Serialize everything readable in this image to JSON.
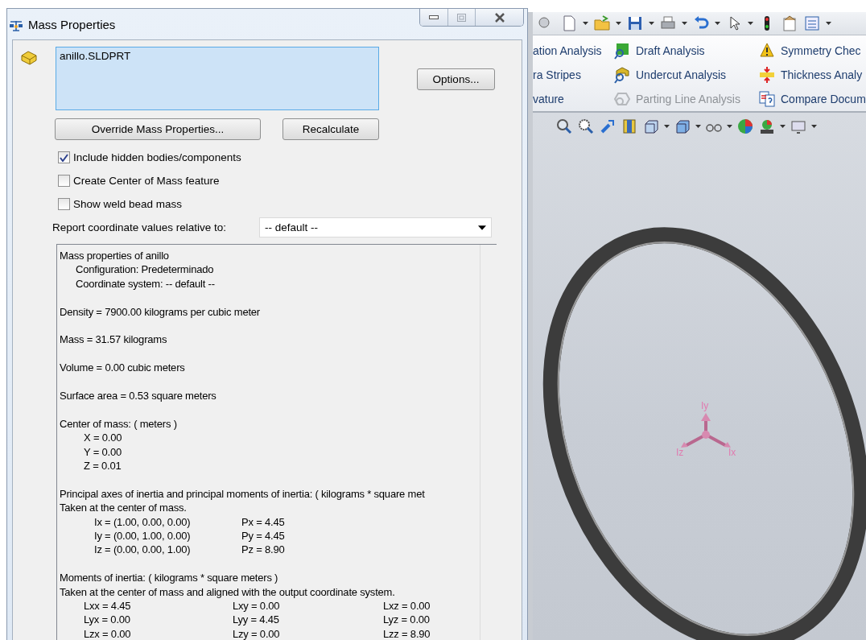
{
  "dialog": {
    "title": "Mass Properties",
    "selection": "anillo.SLDPRT",
    "buttons": {
      "options": "Options...",
      "override": "Override Mass Properties...",
      "recalculate": "Recalculate"
    },
    "checkboxes": [
      {
        "label": "Include hidden bodies/components",
        "checked": true
      },
      {
        "label": "Create Center of Mass feature",
        "checked": false
      },
      {
        "label": "Show weld bead mass",
        "checked": false
      }
    ],
    "coordinate": {
      "label": "Report coordinate values relative to:",
      "value": "-- default --"
    },
    "report": [
      {
        "lines": [
          "Mass properties of anillo"
        ],
        "children": [
          "Configuration: Predeterminado",
          "Coordinate system: -- default --"
        ]
      },
      {
        "lines": [
          "Density = 7900.00 kilograms per cubic meter"
        ]
      },
      {
        "lines": [
          "Mass = 31.57 kilograms"
        ]
      },
      {
        "lines": [
          "Volume = 0.00 cubic meters"
        ]
      },
      {
        "lines": [
          "Surface area = 0.53 square meters"
        ]
      },
      {
        "lines": [
          "Center of mass: ( meters )"
        ],
        "rows": [
          [
            "X = 0.00"
          ],
          [
            "Y = 0.00"
          ],
          [
            "Z = 0.01"
          ]
        ]
      },
      {
        "lines": [
          "Principal axes of inertia and principal moments of inertia: ( kilograms * square met",
          "Taken at the center of mass."
        ],
        "rows": [
          [
            "Ix = (1.00, 0.00, 0.00)",
            "Px = 4.45"
          ],
          [
            "Iy = (0.00, 1.00, 0.00)",
            "Py = 4.45"
          ],
          [
            "Iz = (0.00, 0.00, 1.00)",
            "Pz = 8.90"
          ]
        ]
      },
      {
        "lines": [
          "Moments of inertia: ( kilograms * square meters )",
          "Taken at the center of mass and aligned with the output coordinate system."
        ],
        "rows": [
          [
            "Lxx = 4.45",
            "Lxy = 0.00",
            "Lxz = 0.00"
          ],
          [
            "Lyx = 0.00",
            "Lyy = 4.45",
            "Lyz = 0.00"
          ],
          [
            "Lzx = 0.00",
            "Lzy = 0.00",
            "Lzz = 8.90"
          ]
        ]
      }
    ]
  },
  "command_manager": [
    {
      "label": "ation Analysis",
      "disabled": false,
      "kind": "text"
    },
    {
      "label": "Draft Analysis",
      "disabled": false,
      "kind": "draft"
    },
    {
      "label": "Symmetry Chec",
      "disabled": false,
      "kind": "warning"
    },
    {
      "label": "ra Stripes",
      "disabled": false,
      "kind": "text"
    },
    {
      "label": "Undercut Analysis",
      "disabled": false,
      "kind": "undercut"
    },
    {
      "label": "Thickness Analy",
      "disabled": false,
      "kind": "thickness"
    },
    {
      "label": "vature",
      "disabled": false,
      "kind": "text"
    },
    {
      "label": "Parting Line Analysis",
      "disabled": true,
      "kind": "parting"
    },
    {
      "label": "Compare Docum",
      "disabled": false,
      "kind": "compare"
    }
  ],
  "triad": {
    "y": "Iy",
    "z": "Iz",
    "x": "Ix"
  }
}
